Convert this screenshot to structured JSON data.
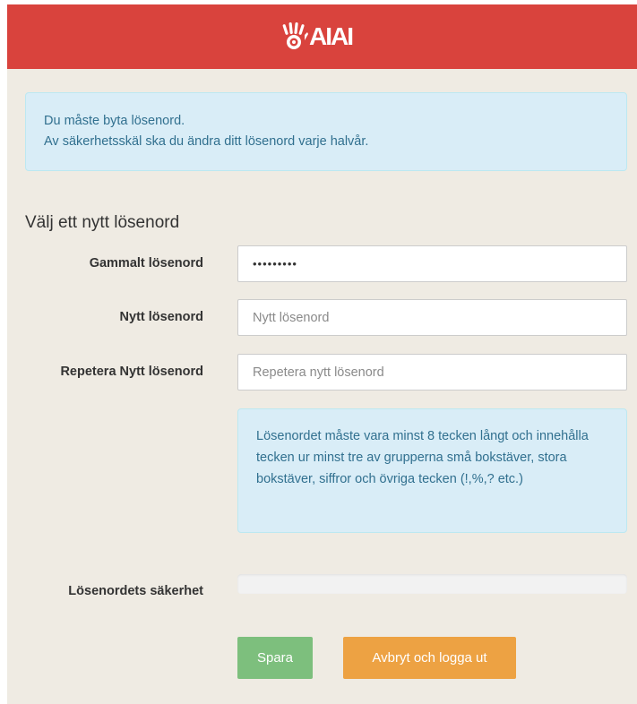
{
  "header": {
    "logo_text": "AIAI",
    "brand_color": "#d9433d",
    "logo_icon": "hand-eye-logo-icon"
  },
  "notice": {
    "line1": "Du måste byta lösenord.",
    "line2": "Av säkerhetsskäl ska du ändra ditt lösenord varje halvår."
  },
  "form": {
    "title": "Välj ett nytt lösenord",
    "old_password": {
      "label": "Gammalt lösenord",
      "value": "•••••••••"
    },
    "new_password": {
      "label": "Nytt lösenord",
      "placeholder": "Nytt lösenord",
      "value": ""
    },
    "repeat_password": {
      "label": "Repetera Nytt lösenord",
      "placeholder": "Repetera nytt lösenord",
      "value": ""
    },
    "hint": "Lösenordet måste vara minst 8 tecken långt och innehålla tecken ur minst tre av grupperna små bokstäver, stora bokstäver, siffror och övriga tecken (!,%,? etc.)",
    "strength": {
      "label": "Lösenordets säkerhet",
      "level_fraction": 0
    }
  },
  "buttons": {
    "save_label": "Spara",
    "cancel_label": "Avbryt och logga ut",
    "save_color": "#7dbf7d",
    "cancel_color": "#eda243"
  }
}
